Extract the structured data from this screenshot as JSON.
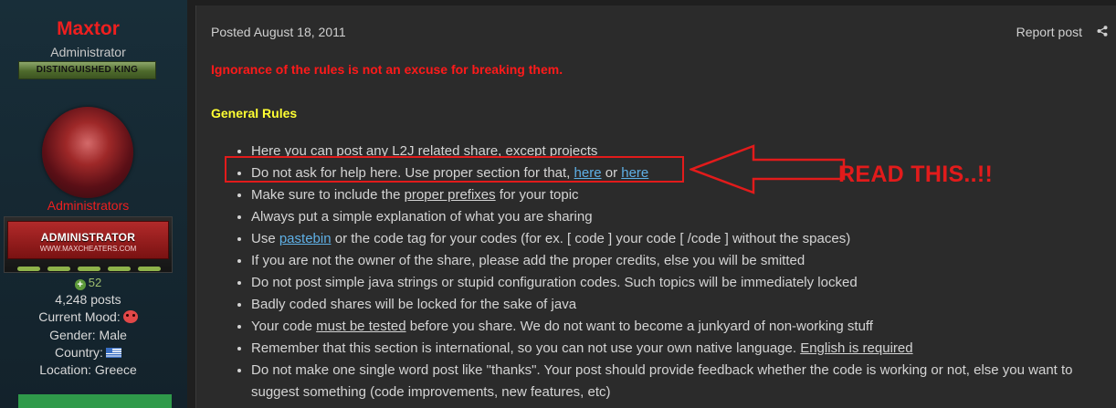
{
  "author": {
    "name": "Maxtor",
    "title": "Administrator",
    "rank": "DISTINGUISHED KING",
    "group": "Administrators",
    "badge_main": "ADMINISTRATOR",
    "badge_sub": "WWW.MAXCHEATERS.COM",
    "reputation": "52",
    "posts": "4,248 posts",
    "mood_label": "Current Mood:",
    "gender": "Gender: Male",
    "country_label": "Country:",
    "location": "Location: Greece"
  },
  "post": {
    "date": "Posted August 18, 2011",
    "report": "Report post",
    "warning": "Ignorance of the rules is not an excuse for breaking them.",
    "rules_title": "General Rules",
    "rules": {
      "r1_text": "Here you can post any L2J related share, ",
      "r1_link": "except projects",
      "r2_text": "Do not ask for help here. Use proper section for that, ",
      "r2_link1": "here",
      "r2_or": " or ",
      "r2_link2": "here",
      "r3_text": "Make sure to include the ",
      "r3_link": "proper prefixes",
      "r3_tail": " for your topic",
      "r4_text": "Always put a simple explanation of what you are sharing",
      "r5_text": "Use ",
      "r5_link": "pastebin",
      "r5_tail": " or the code tag for your codes (for ex. [ code ] your code [ /code ] without the spaces)",
      "r6_text": "If you are not the owner of the share, please add the proper credits, else you will be smitted",
      "r7_text": "Do not post simple java strings or stupid configuration codes. Such topics will be immediately locked",
      "r8_text": "Badly coded shares will be locked for the sake of java",
      "r9_text": "Your code ",
      "r9_link": "must be tested",
      "r9_tail": " before you share. We do not want to become a junkyard of non-working stuff",
      "r10_text": "Remember that this section is international, so you can not use your own native language. ",
      "r10_link": "English is required",
      "r11_text": "Do not make one single word post like \"thanks\". Your post should provide feedback whether the code is working or not, else you want to suggest something (code improvements, new features, etc)"
    },
    "annotation": "READ THIS..!!"
  },
  "colors": {
    "accent_red": "#e21b1b",
    "title_yellow": "#ffff33",
    "link_blue": "#5fb0e6"
  },
  "icons": {
    "share": "share-icon",
    "reputation": "plus-circle-icon",
    "mood": "angry-face-icon",
    "country": "greece-flag-icon"
  }
}
